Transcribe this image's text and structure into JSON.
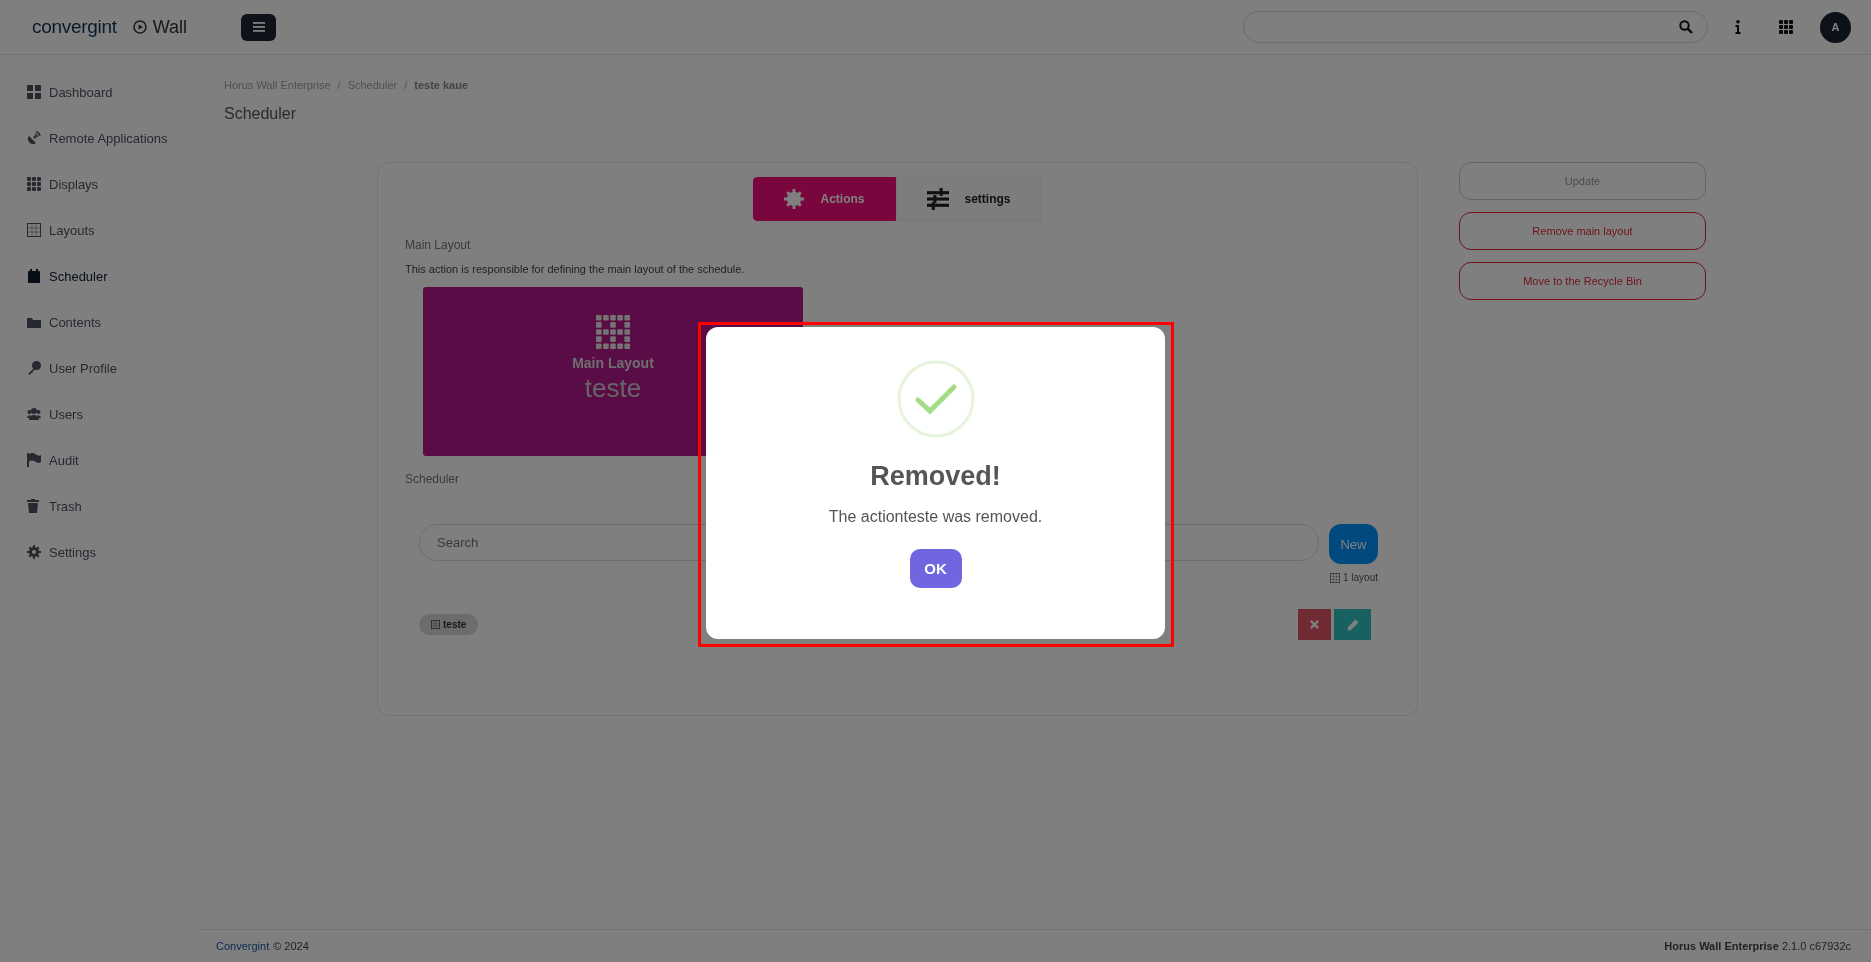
{
  "header": {
    "brand": "convergint",
    "app_name": "Wall",
    "avatar": "A"
  },
  "sidebar": {
    "items": [
      {
        "label": "Dashboard",
        "selected": false
      },
      {
        "label": "Remote Applications",
        "selected": false
      },
      {
        "label": "Displays",
        "selected": false
      },
      {
        "label": "Layouts",
        "selected": false
      },
      {
        "label": "Scheduler",
        "selected": true
      },
      {
        "label": "Contents",
        "selected": false
      },
      {
        "label": "User Profile",
        "selected": false
      },
      {
        "label": "Users",
        "selected": false
      },
      {
        "label": "Audit",
        "selected": false
      },
      {
        "label": "Trash",
        "selected": false
      },
      {
        "label": "Settings",
        "selected": false
      }
    ]
  },
  "breadcrumb": {
    "separator": "/",
    "items": [
      "Horus Wall Enterprise",
      "Scheduler",
      "teste kaue"
    ]
  },
  "page_title": "Scheduler",
  "tabs": [
    {
      "label": "Actions",
      "selected": true
    },
    {
      "label": "settings",
      "selected": false
    }
  ],
  "main_layout": {
    "title": "Main Layout",
    "description": "This action is responsible for defining the main layout of the schedule.",
    "card_label": "Main Layout",
    "card_value": "teste"
  },
  "scheduler": {
    "title": "Scheduler",
    "search": {
      "placeholder": "Search"
    },
    "new_button": "New",
    "count": "1 layout",
    "items": [
      {
        "label": "teste"
      }
    ]
  },
  "side_actions": [
    {
      "label": "Update",
      "kind": "neutral"
    },
    {
      "label": "Remove main layout",
      "kind": "danger"
    },
    {
      "label": "Move to the Recycle Bin",
      "kind": "danger"
    }
  ],
  "dialog": {
    "title": "Removed!",
    "message": "The actionteste was removed.",
    "button": "OK"
  },
  "footer": {
    "link": "Convergint",
    "copyright": "© 2024",
    "version": "**Horus Wall Enterprise** 2.1.0 c67932c"
  }
}
